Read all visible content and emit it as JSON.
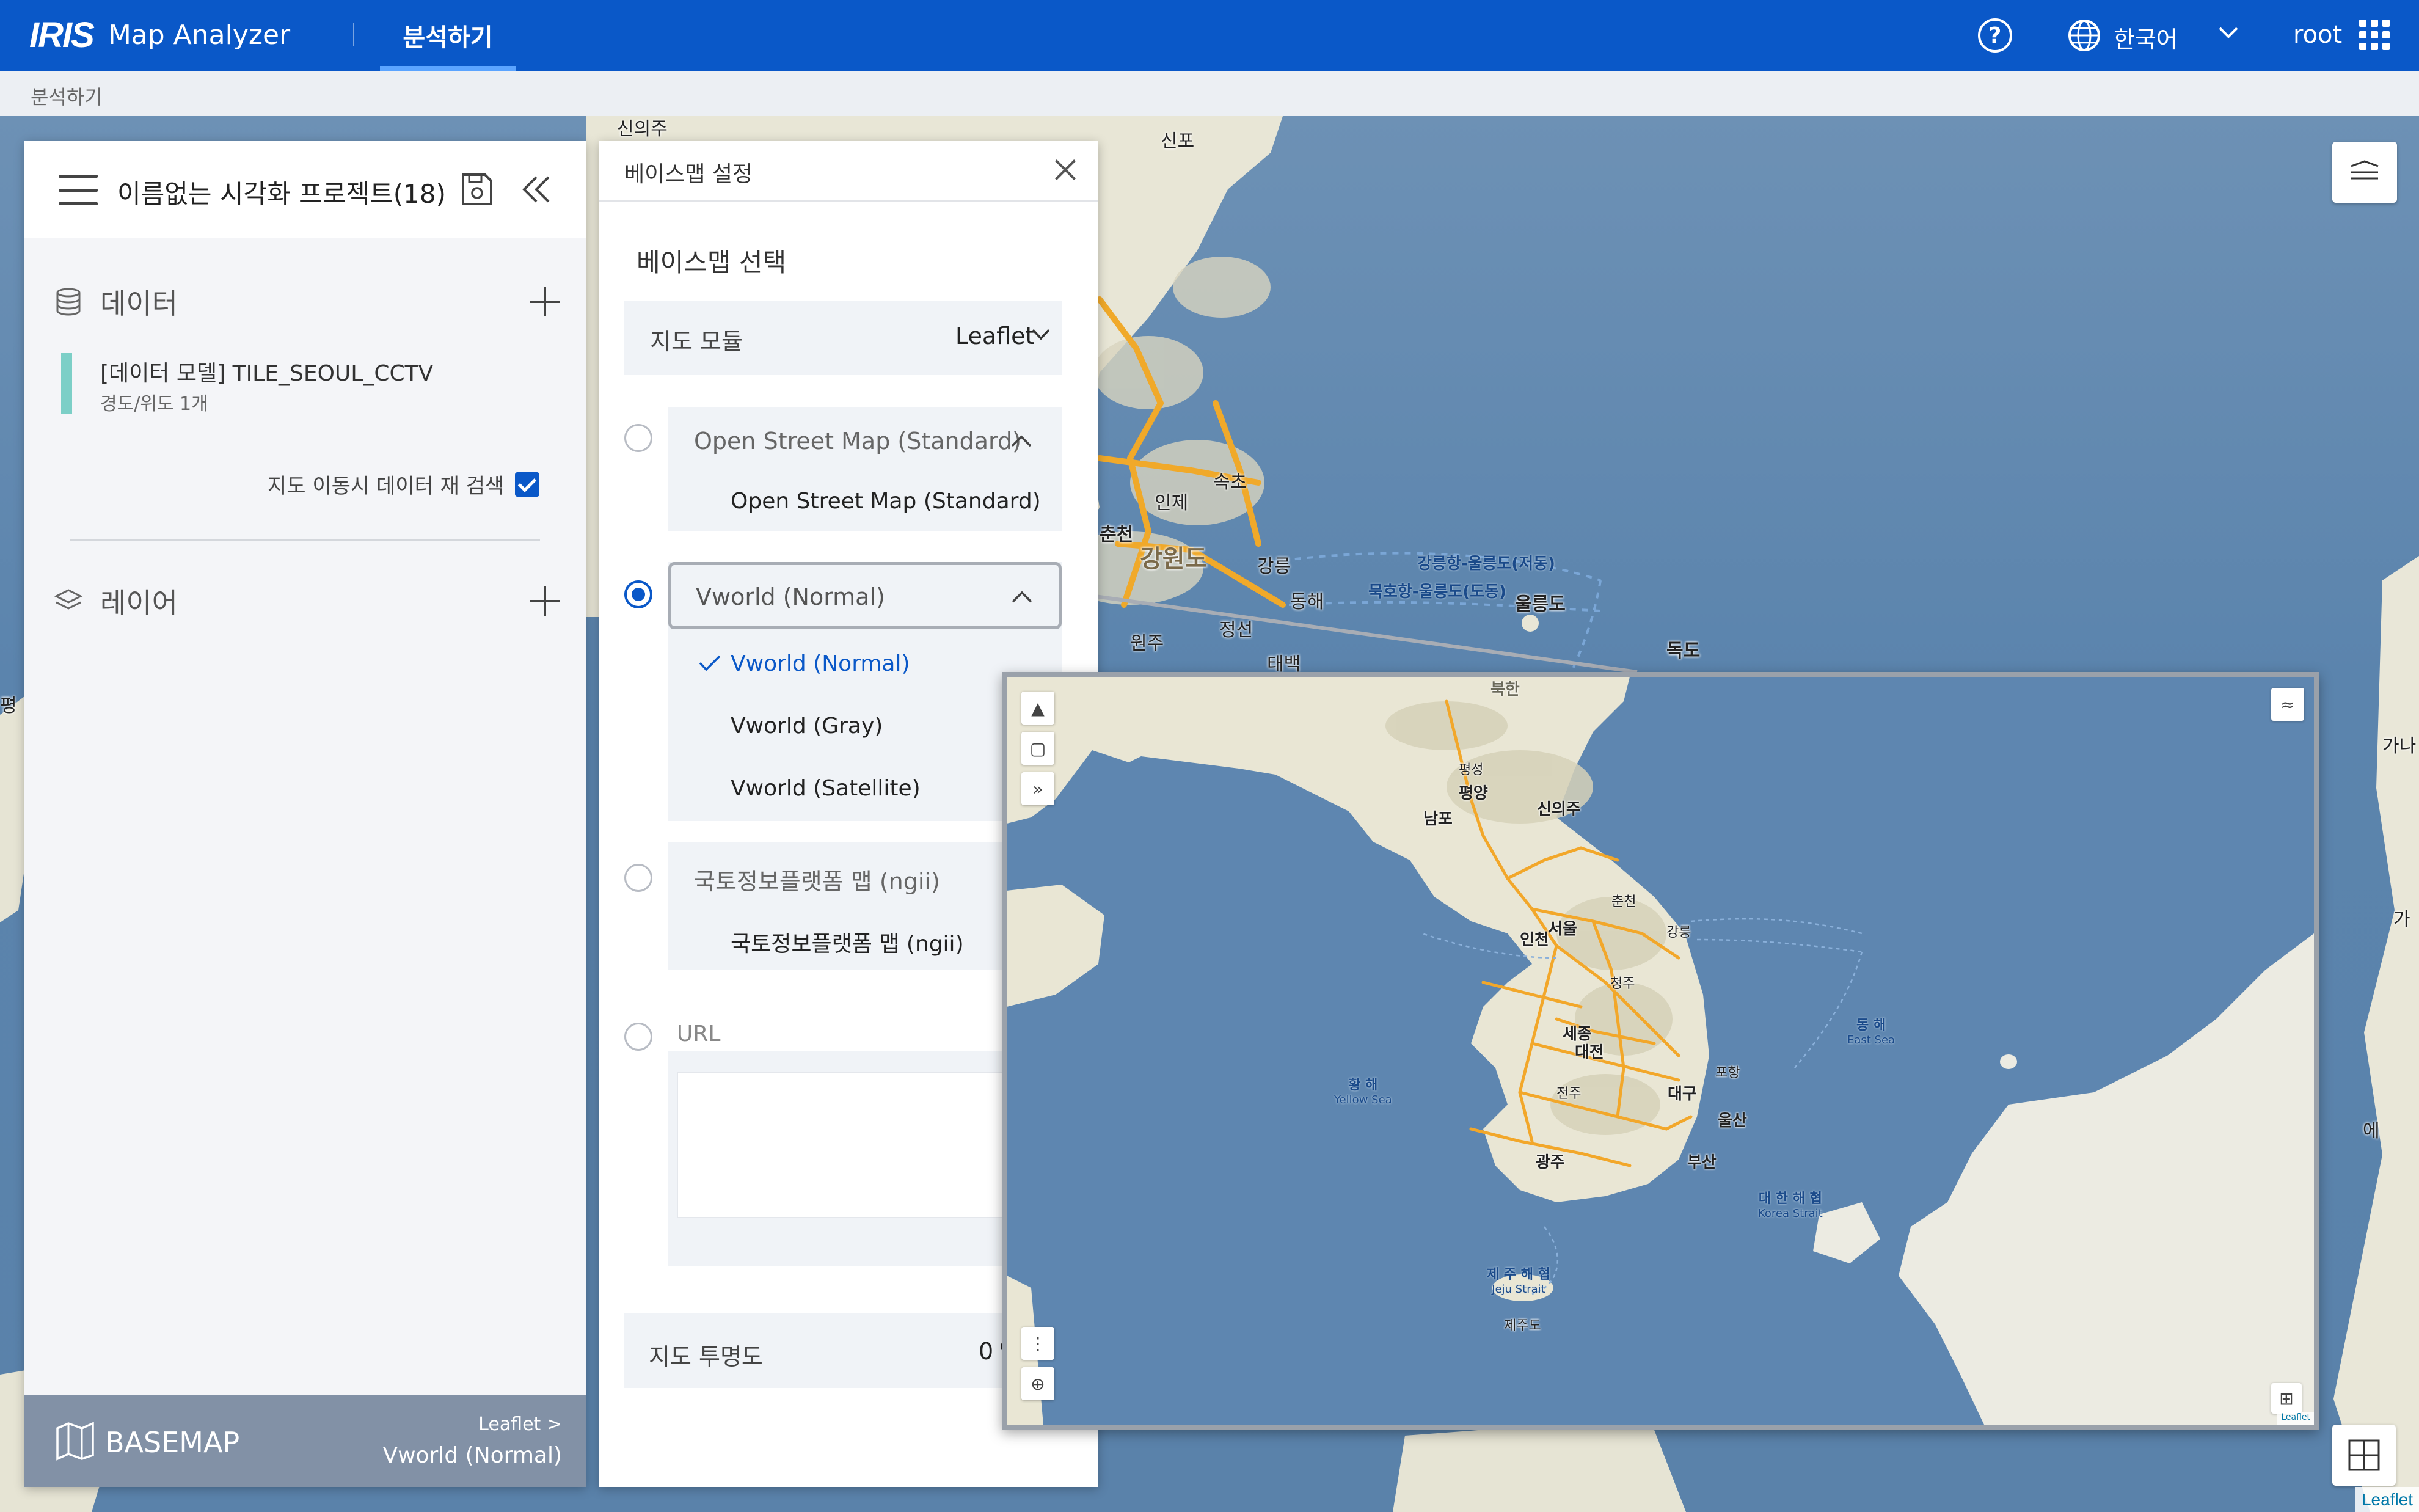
{
  "app": {
    "logo_mark": "IRIS",
    "name": "Map Analyzer",
    "active_tab": "분석하기",
    "language": "한국어",
    "user": "root",
    "accent_color": "#0a58c8"
  },
  "breadcrumb": "분석하기",
  "project": {
    "title": "이름없는 시각화 프로젝트(18)"
  },
  "data_section": {
    "title": "데이터",
    "items": [
      {
        "name": "[데이터 모델] TILE_SEOUL_CCTV",
        "sub": "경도/위도 1개",
        "color": "#7ccfc7"
      }
    ],
    "refetch_label": "지도 이동시 데이터 재 검색",
    "refetch_checked": true
  },
  "layer_section": {
    "title": "레이어"
  },
  "basemap_footer": {
    "title": "BASEMAP",
    "module": "Leaflet >",
    "name": "Vworld (Normal)"
  },
  "settings": {
    "title": "베이스맵 설정",
    "section": "베이스맵 선택",
    "module_label": "지도 모듈",
    "module_value": "Leaflet",
    "groups": [
      {
        "label": "Open Street Map (Standard)",
        "selected": false,
        "options": [
          "Open Street Map (Standard)"
        ]
      },
      {
        "label": "Vworld (Normal)",
        "selected": true,
        "options": [
          "Vworld (Normal)",
          "Vworld (Gray)",
          "Vworld (Satellite)"
        ],
        "active_option": "Vworld (Normal)"
      },
      {
        "label": "국토정보플랫폼 맵 (ngii)",
        "selected": false,
        "options": [
          "국토정보플랫폼 맵 (ngii)"
        ]
      }
    ],
    "url_label": "URL",
    "url_value": "",
    "opacity_label": "지도 투명도",
    "opacity_value": "0",
    "opacity_unit": "%"
  },
  "map": {
    "attribution": "Leaflet",
    "labels": [
      "신의주",
      "신포",
      "속초",
      "인제",
      "춘천",
      "강원도",
      "강릉",
      "동해",
      "정선",
      "원주",
      "태백",
      "강릉항-울릉도(저동)",
      "묵호항-울릉도(도동)",
      "울릉도",
      "독도",
      "가",
      "가나",
      "에",
      "평"
    ]
  },
  "preview": {
    "attribution": "Leaflet",
    "cities": [
      "신의주",
      "북한",
      "평성",
      "평양",
      "남포",
      "서울",
      "인천",
      "세종",
      "대전",
      "대구",
      "울산",
      "광주",
      "부산",
      "제주도",
      "춘천",
      "강릉",
      "청주",
      "전주",
      "포항"
    ],
    "seas": [
      {
        "ko": "황 해",
        "en": "Yellow Sea"
      },
      {
        "ko": "동 해",
        "en": "East Sea"
      },
      {
        "ko": "대 한 해 협",
        "en": "Korea Strait"
      },
      {
        "ko": "제 주 해 협",
        "en": "Jeju Strait"
      }
    ]
  }
}
